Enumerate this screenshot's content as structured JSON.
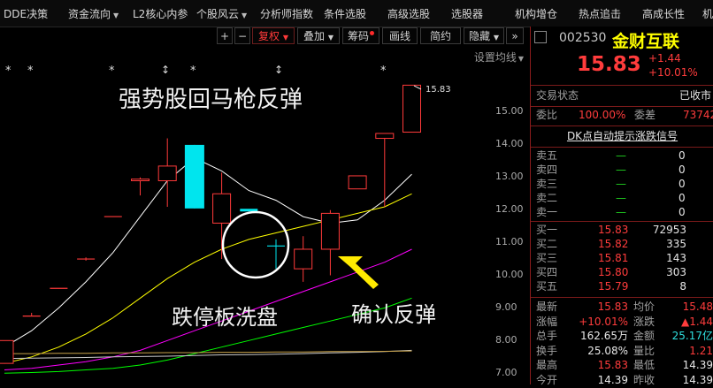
{
  "menu": {
    "items": [
      {
        "label": "DDE决策",
        "caret": false
      },
      {
        "label": "资金流向",
        "caret": true
      },
      {
        "label": "L2核心内参",
        "caret": false
      },
      {
        "label": "个股风云",
        "caret": true
      },
      {
        "label": "分析师指数",
        "caret": false
      },
      {
        "label": "条件选股",
        "caret": false
      },
      {
        "label": "高级选股",
        "caret": false
      },
      {
        "label": "选股器",
        "caret": false
      },
      {
        "label": "机构增仓",
        "caret": false
      },
      {
        "label": "热点追击",
        "caret": false
      },
      {
        "label": "高成长性",
        "caret": false
      },
      {
        "label": "机",
        "caret": false
      }
    ]
  },
  "toolbar": {
    "plus": "+",
    "minus": "−",
    "fuquan": "复权",
    "diejia": "叠加",
    "chouma": "筹码",
    "huaxian": "画线",
    "jianyue": "简约",
    "yincang": "隐藏",
    "expand": "»",
    "markers": [
      "*",
      "*",
      "*",
      "↕",
      "*",
      "↕",
      "*"
    ]
  },
  "chart": {
    "setting_label": "设置均线",
    "last_price_tag": "15.83",
    "annotations": {
      "title": "强势股回马枪反弹",
      "limit_down_wash": "跌停板洗盘",
      "confirm_rebound": "确认反弹"
    },
    "colors": {
      "up": "#ff3a3a",
      "down": "#00e5ee",
      "ma5": "#ffffff",
      "ma10": "#ffff00",
      "ma20": "#ff00ff",
      "ma60": "#00ff00",
      "annotation_arrow": "#ffea00"
    }
  },
  "chart_data": {
    "type": "candlestick",
    "yticks": [
      "15.00",
      "14.00",
      "13.00",
      "12.00",
      "11.00",
      "10.00",
      "9.00",
      "8.00",
      "7.00"
    ],
    "ylim": [
      6.8,
      16.5
    ],
    "candles": [
      {
        "open": 8.0,
        "close": 7.3,
        "high": 8.0,
        "low": 7.3
      },
      {
        "open": 8.75,
        "close": 8.75,
        "high": 8.85,
        "low": 8.75
      },
      {
        "open": 9.6,
        "close": 9.6,
        "high": 9.6,
        "low": 9.6
      },
      {
        "open": 10.5,
        "close": 10.5,
        "high": 10.55,
        "low": 10.45
      },
      {
        "open": 11.8,
        "close": 11.8,
        "high": 11.8,
        "low": 11.8
      },
      {
        "open": 12.9,
        "close": 12.95,
        "high": 13.0,
        "low": 12.45
      },
      {
        "open": 12.9,
        "close": 13.35,
        "high": 14.2,
        "low": 12.1
      },
      {
        "open": 14.0,
        "close": 12.05,
        "high": 14.0,
        "low": 12.05
      },
      {
        "open": 12.5,
        "close": 11.6,
        "high": 13.15,
        "low": 10.5
      },
      {
        "open": 12.0,
        "close": 12.0,
        "high": 12.0,
        "low": 12.0
      },
      {
        "open": 10.9,
        "close": 10.9,
        "high": 11.1,
        "low": 10.2
      },
      {
        "open": 10.2,
        "close": 10.8,
        "high": 11.2,
        "low": 9.8
      },
      {
        "open": 10.8,
        "close": 11.9,
        "high": 12.0,
        "low": 10.0
      },
      {
        "open": 12.65,
        "close": 13.05,
        "high": 13.05,
        "low": 12.65
      },
      {
        "open": 14.2,
        "close": 14.35,
        "high": 14.35,
        "low": 12.1
      },
      {
        "open": 14.39,
        "close": 15.83,
        "high": 15.83,
        "low": 14.39
      }
    ],
    "series": [
      {
        "name": "MA5",
        "color": "#ffffff",
        "values": [
          7.8,
          8.3,
          9.0,
          9.8,
          10.7,
          11.8,
          12.9,
          13.6,
          13.2,
          12.6,
          12.3,
          11.8,
          11.6,
          11.7,
          12.3,
          13.1
        ]
      },
      {
        "name": "MA10",
        "color": "#ffff00",
        "values": [
          7.3,
          7.5,
          7.8,
          8.2,
          8.7,
          9.3,
          9.9,
          10.4,
          10.8,
          11.1,
          11.3,
          11.5,
          11.7,
          11.9,
          12.1,
          12.5
        ]
      },
      {
        "name": "MA20",
        "color": "#ff00ff",
        "values": [
          7.1,
          7.15,
          7.25,
          7.35,
          7.5,
          7.7,
          8.0,
          8.3,
          8.6,
          8.9,
          9.2,
          9.5,
          9.8,
          10.1,
          10.4,
          10.8
        ]
      },
      {
        "name": "MA60",
        "color": "#00ff00",
        "values": [
          7.0,
          7.02,
          7.05,
          7.1,
          7.15,
          7.25,
          7.4,
          7.6,
          7.8,
          8.0,
          8.2,
          8.4,
          8.6,
          8.8,
          9.0,
          9.3
        ]
      },
      {
        "name": "MA120",
        "color": "#cccccc",
        "values": [
          7.45,
          7.46,
          7.47,
          7.48,
          7.5,
          7.51,
          7.52,
          7.54,
          7.56,
          7.57,
          7.58,
          7.6,
          7.62,
          7.64,
          7.66,
          7.7
        ]
      },
      {
        "name": "MA250",
        "color": "#c8a24a",
        "values": [
          7.6,
          7.6,
          7.61,
          7.61,
          7.62,
          7.62,
          7.63,
          7.63,
          7.64,
          7.64,
          7.65,
          7.65,
          7.66,
          7.66,
          7.67,
          7.68
        ]
      }
    ]
  },
  "quote": {
    "code": "002530",
    "name": "金财互联",
    "price": "15.83",
    "change": "+1.44",
    "change_pct": "+10.01%",
    "trade_status_label": "交易状态",
    "trade_status_value": "已收市",
    "weibi_label": "委比",
    "weibi_value": "100.00%",
    "weicha_label": "委差",
    "weicha_value": "73742",
    "dk_signal": "DK点自动提示涨跌信号",
    "sells": [
      {
        "label": "卖五",
        "price": "—",
        "vol": "0"
      },
      {
        "label": "卖四",
        "price": "—",
        "vol": "0"
      },
      {
        "label": "卖三",
        "price": "—",
        "vol": "0"
      },
      {
        "label": "卖二",
        "price": "—",
        "vol": "0"
      },
      {
        "label": "卖一",
        "price": "—",
        "vol": "0"
      }
    ],
    "buys": [
      {
        "label": "买一",
        "price": "15.83",
        "vol": "72953"
      },
      {
        "label": "买二",
        "price": "15.82",
        "vol": "335"
      },
      {
        "label": "买三",
        "price": "15.81",
        "vol": "143"
      },
      {
        "label": "买四",
        "price": "15.80",
        "vol": "303"
      },
      {
        "label": "买五",
        "price": "15.79",
        "vol": "8"
      }
    ],
    "stats": [
      {
        "l1": "最新",
        "v1": "15.83",
        "l2": "均价",
        "v2": "15.48",
        "c1": "red",
        "c2": "red"
      },
      {
        "l1": "涨幅",
        "v1": "+10.01%",
        "l2": "涨跌",
        "v2": "▲1.44",
        "c1": "red",
        "c2": "red"
      },
      {
        "l1": "总手",
        "v1": "162.65万",
        "l2": "金额",
        "v2": "25.17亿",
        "c1": "white",
        "c2": "cyan"
      },
      {
        "l1": "换手",
        "v1": "25.08%",
        "l2": "量比",
        "v2": "1.21",
        "c1": "white",
        "c2": "red"
      },
      {
        "l1": "最高",
        "v1": "15.83",
        "l2": "最低",
        "v2": "14.39",
        "c1": "red",
        "c2": "white"
      },
      {
        "l1": "今开",
        "v1": "14.39",
        "l2": "昨收",
        "v2": "14.39",
        "c1": "white",
        "c2": "white"
      }
    ]
  }
}
